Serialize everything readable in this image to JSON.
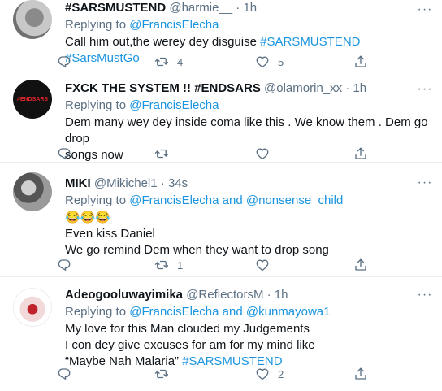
{
  "tweets": [
    {
      "name": "#SARSMUSTEND",
      "handle": "@harmie__",
      "time": "1h",
      "replying_label": "Replying to",
      "replying_to": "@FrancisElecha",
      "replying_and": "",
      "replying_to2": "",
      "text": "Call him out,the werey dey disguise",
      "hashtags": "#SARSMUSTEND #SarsMustGo",
      "retweets": "4",
      "likes": "5"
    },
    {
      "name": "FXCK THE SYSTEM !! #ENDSARS",
      "handle": "@olamorin_xx",
      "time": "1h",
      "avatar_text": "#ENDSARS",
      "replying_label": "Replying to",
      "replying_to": "@FrancisElecha",
      "text_line1": "Dem many wey dey inside coma like this . We know them . Dem go drop",
      "text_line2": "songs now",
      "retweets": "",
      "likes": ""
    },
    {
      "name": "MIKI",
      "handle": "@Mikichel1",
      "time": "34s",
      "replying_label": "Replying to",
      "replying_to": "@FrancisElecha",
      "replying_and": "and",
      "replying_to2": "@nonsense_child",
      "emoji": "😂😂😂",
      "text_line1": "Even kiss Daniel",
      "text_line2": "We go remind Dem when they want to drop song",
      "retweets": "1",
      "likes": ""
    },
    {
      "name": "Adeogooluwayimika",
      "handle": "@ReflectorsM",
      "time": "1h",
      "replying_label": "Replying to",
      "replying_to": "@FrancisElecha",
      "replying_and": "and",
      "replying_to2": "@kunmayowa1",
      "text_line1": "My love for this Man clouded my Judgements",
      "text_line2": "I con dey give excuses for am for my mind like",
      "text_line3": "“Maybe Nah Malaria”",
      "hashtag": "#SARSMUSTEND",
      "retweets": "",
      "likes": "2"
    }
  ],
  "icons": {
    "more": "more-icon",
    "reply": "reply-icon",
    "retweet": "retweet-icon",
    "like": "heart-icon",
    "share": "share-icon"
  },
  "colors": {
    "link": "#1b95e0",
    "muted": "#5b7083",
    "text": "#0f1419",
    "divider": "#ebeef0"
  }
}
